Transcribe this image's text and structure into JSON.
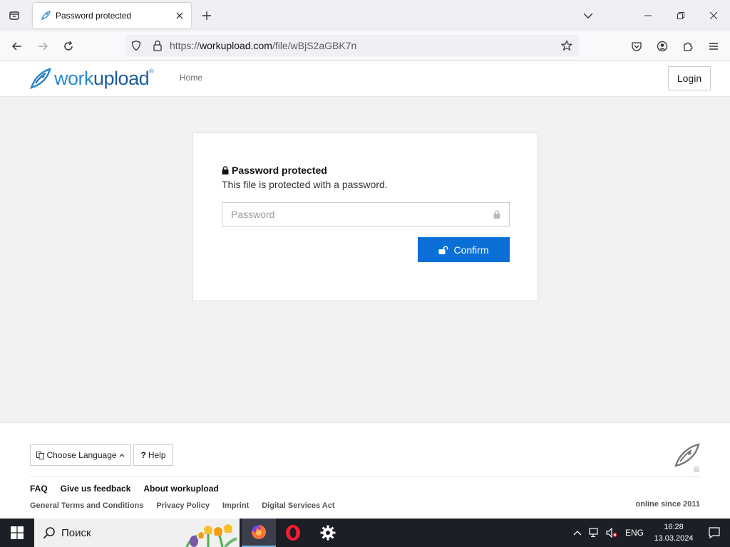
{
  "browser": {
    "tab_title": "Password protected",
    "url_prefix": "https://",
    "url_domain": "workupload.com",
    "url_path": "/file/wBjS2aGBK7n"
  },
  "site": {
    "logo_text_a": "work",
    "logo_text_b": "upload",
    "logo_reg": "®",
    "nav_home": "Home",
    "login_label": "Login"
  },
  "card": {
    "heading": "Password protected",
    "description": "This file is protected with a password.",
    "password_placeholder": "Password",
    "password_value": "",
    "confirm_label": "Confirm"
  },
  "footer": {
    "language_label": "Choose Language",
    "help_label": "Help",
    "links_primary": [
      "FAQ",
      "Give us feedback",
      "About workupload"
    ],
    "links_secondary": [
      "General Terms and Conditions",
      "Privacy Policy",
      "Imprint",
      "Digital Services Act"
    ],
    "online_since": "online since 2011"
  },
  "taskbar": {
    "search_placeholder": "Поиск",
    "language": "ENG",
    "time": "16:28",
    "date": "13.03.2024"
  },
  "colors": {
    "brand_blue": "#0a6fd6",
    "logo_blue": "#2b8ad1"
  }
}
